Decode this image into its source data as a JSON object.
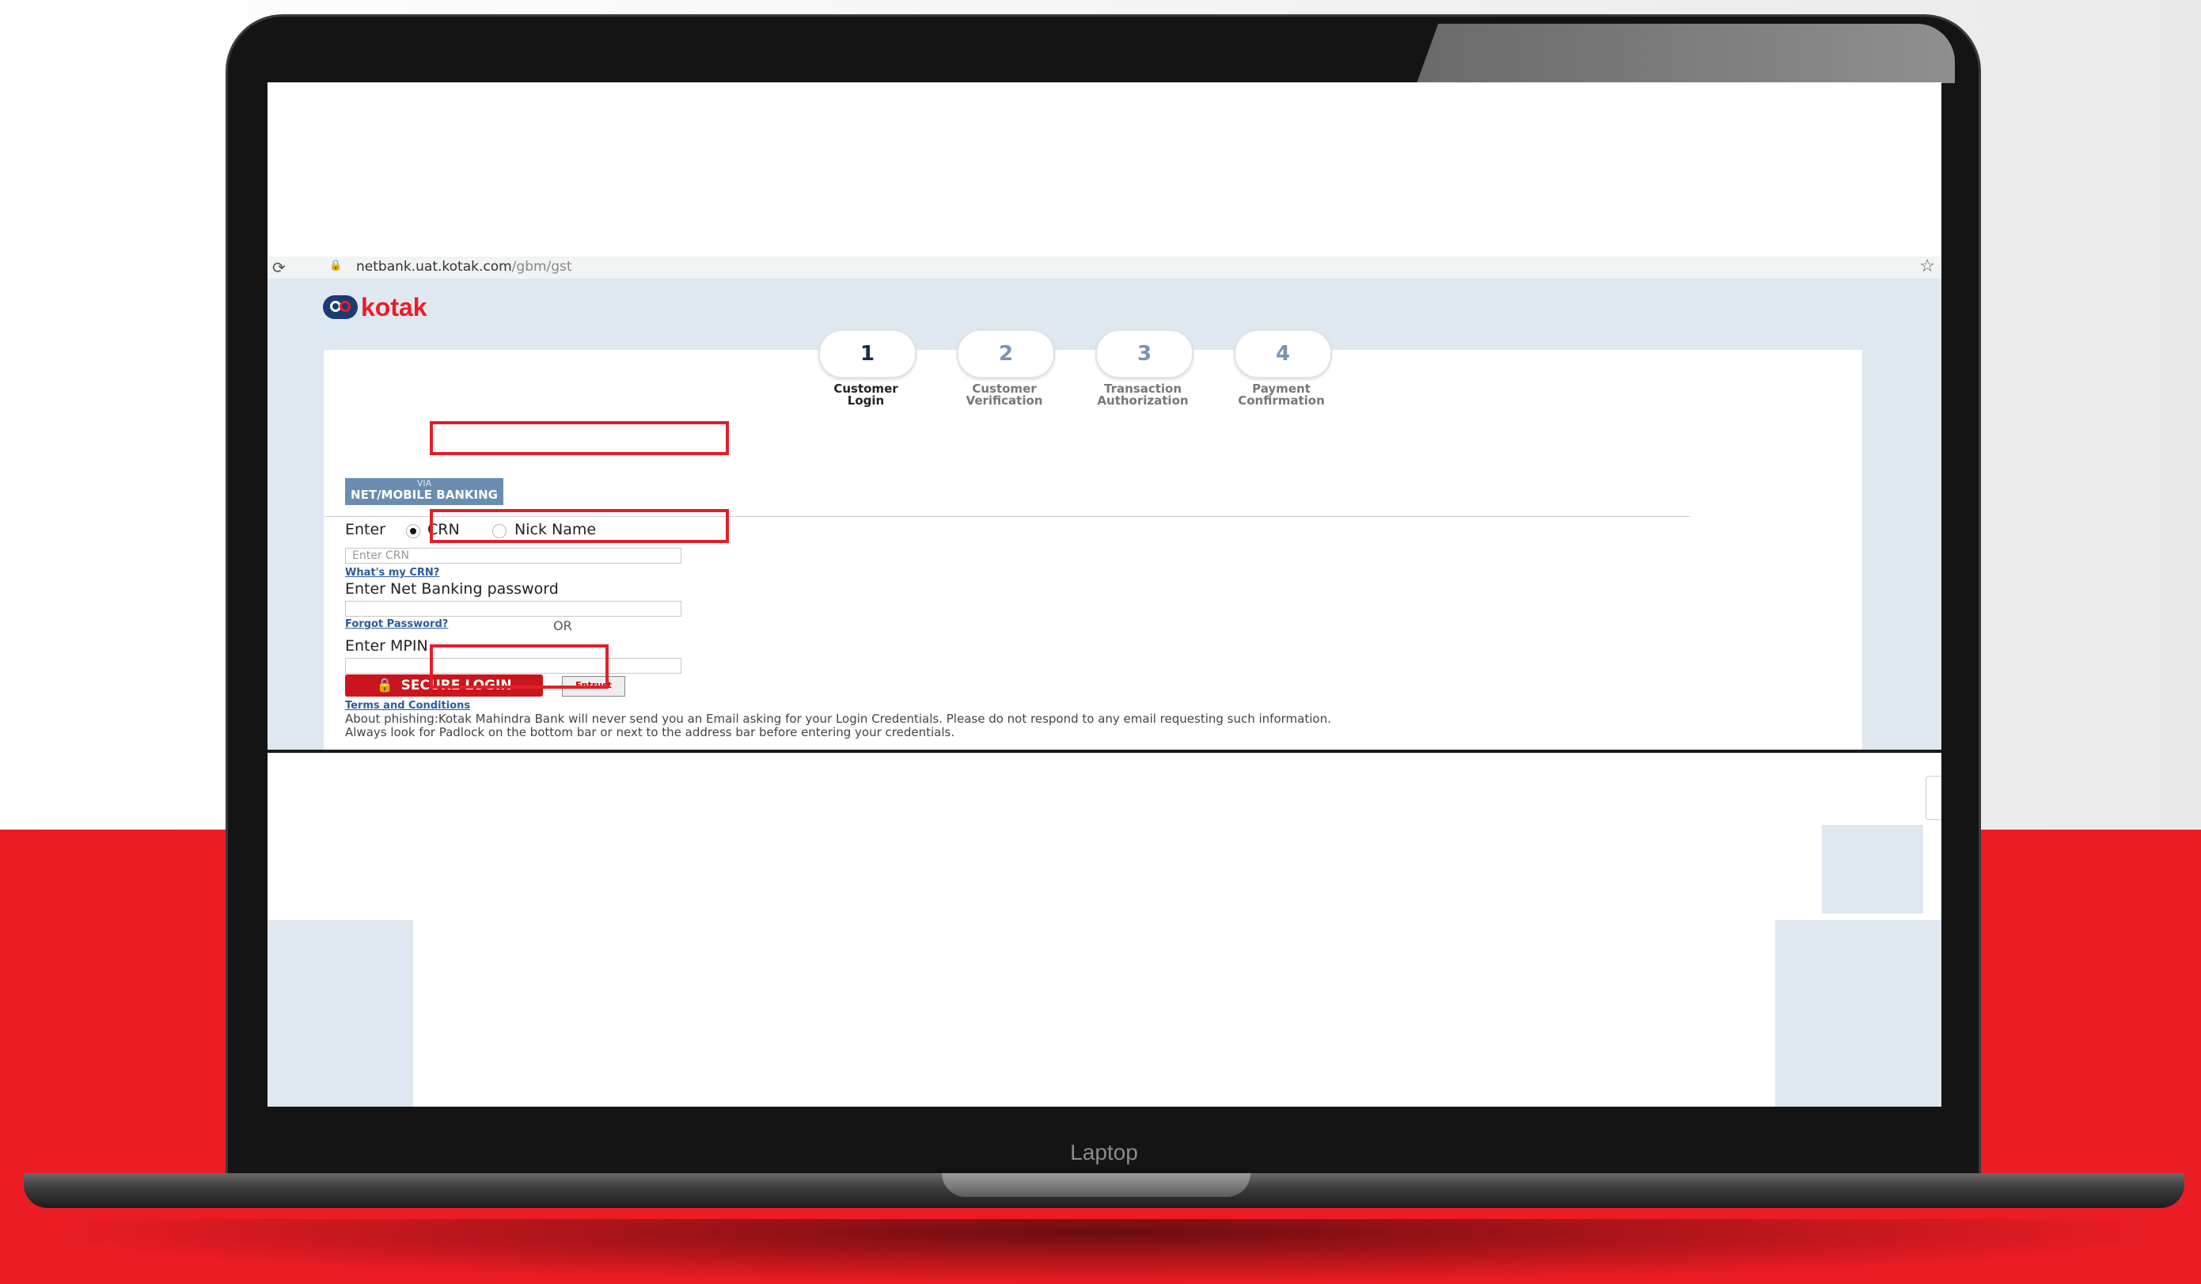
{
  "browser": {
    "url_host": "netbank.uat.kotak.com",
    "url_path": "/gbm/gst"
  },
  "bank": {
    "brand_name": "kotak",
    "brand_color": "#ec1c24",
    "brand_blue": "#1b3b73"
  },
  "steps": [
    {
      "number": "1",
      "line1": "Customer",
      "line2": "Login",
      "active": true
    },
    {
      "number": "2",
      "line1": "Customer",
      "line2": "Verification",
      "active": false
    },
    {
      "number": "3",
      "line1": "Transaction",
      "line2": "Authorization",
      "active": false
    },
    {
      "number": "4",
      "line1": "Payment",
      "line2": "Confirmation",
      "active": false
    }
  ],
  "login": {
    "tab_prefix": "VIA",
    "tab_label": "NET/MOBILE BANKING",
    "enter_label": "Enter",
    "option_crn": "CRN",
    "option_nickname": "Nick Name",
    "crn_placeholder": "Enter CRN",
    "whats_crn_link": "What's my CRN?",
    "password_label": "Enter Net Banking password",
    "forgot_password_link": "Forgot Password?",
    "or_label": "OR",
    "mpin_label": "Enter MPIN",
    "secure_login_button": "SECURE LOGIN",
    "entrust_badge": "Entrust",
    "terms_link": "Terms and Conditions",
    "phishing_line1": "About phishing:Kotak Mahindra Bank will never send you an Email asking for your Login Credentials. Please do not respond to any email requesting such information.",
    "phishing_line2": "Always look for Padlock on the bottom bar or next to the address bar before entering your credentials."
  },
  "device": {
    "label": "Laptop"
  },
  "colors": {
    "highlight_box": "#e0202a",
    "page_background": "#dfe7f0",
    "tab_blue": "#6a8cb1",
    "button_red": "#c9151b"
  }
}
